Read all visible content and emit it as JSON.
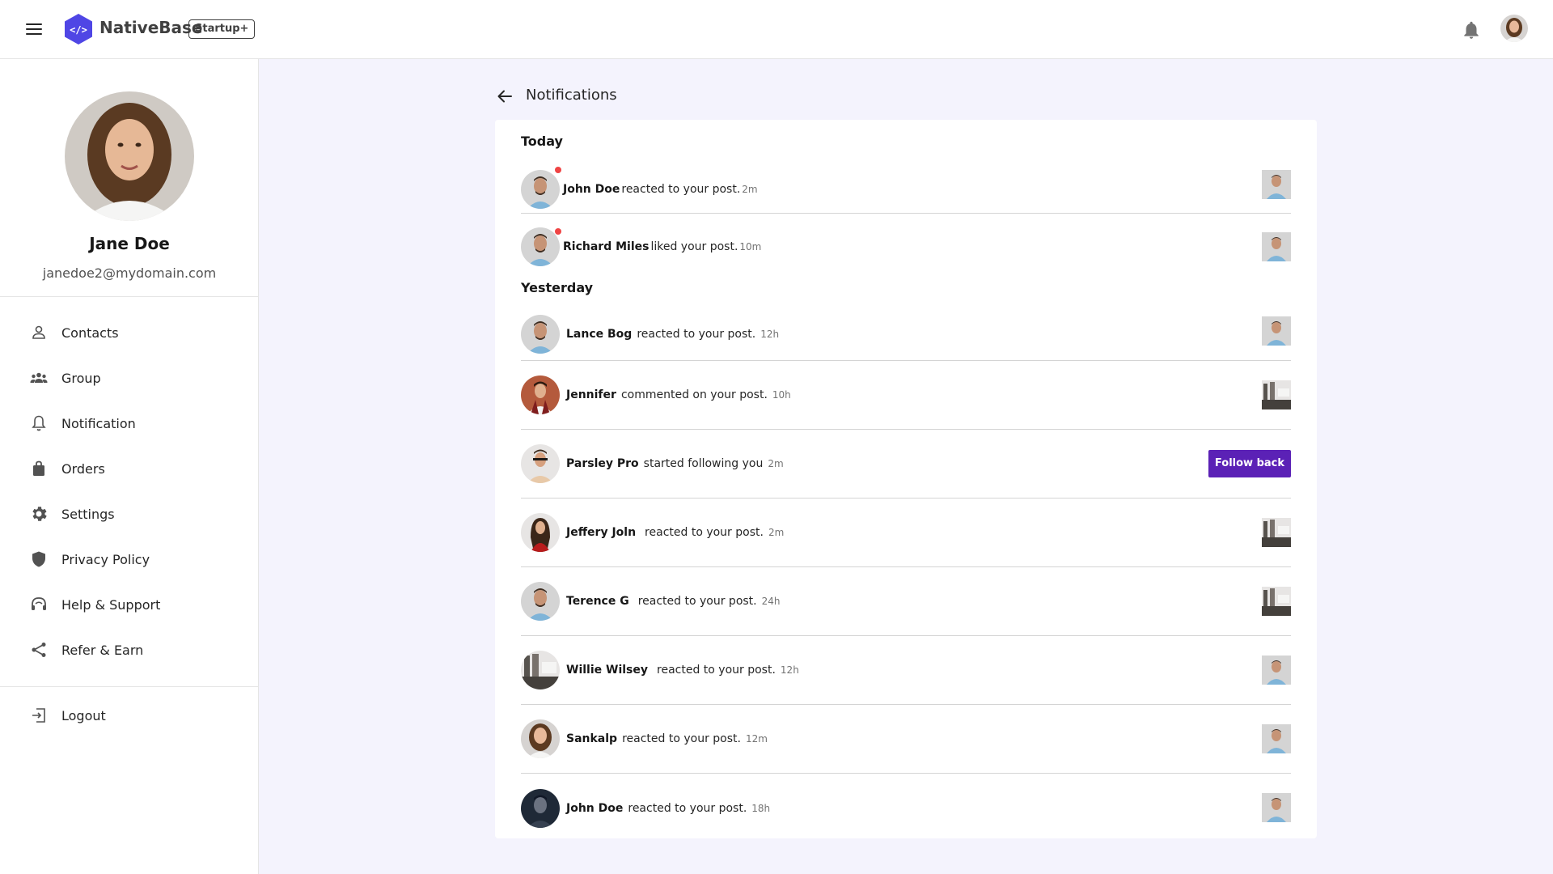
{
  "header": {
    "brand": "NativeBase",
    "plan_badge": "Startup+"
  },
  "sidebar": {
    "profile": {
      "name": "Jane Doe",
      "email": "janedoe2@mydomain.com"
    },
    "items": [
      {
        "label": "Contacts",
        "icon": "person-icon"
      },
      {
        "label": "Group",
        "icon": "group-icon"
      },
      {
        "label": "Notification",
        "icon": "bell-icon"
      },
      {
        "label": "Orders",
        "icon": "bag-icon"
      },
      {
        "label": "Settings",
        "icon": "gear-icon"
      },
      {
        "label": "Privacy Policy",
        "icon": "shield-icon"
      },
      {
        "label": "Help & Support",
        "icon": "headset-icon"
      },
      {
        "label": "Refer & Earn",
        "icon": "share-icon"
      }
    ],
    "logout": {
      "label": "Logout",
      "icon": "logout-icon"
    }
  },
  "main": {
    "title": "Notifications",
    "sections": [
      {
        "title": "Today",
        "items": [
          {
            "name": "John Doe",
            "action": "reacted to your post.",
            "time": "2m",
            "unread": true,
            "thumb": "person-photo"
          },
          {
            "name": "Richard Miles",
            "action": "liked your post.",
            "time": "10m",
            "unread": true,
            "thumb": "person-photo"
          }
        ]
      },
      {
        "title": "Yesterday",
        "items": [
          {
            "name": "Lance Bog",
            "action": "reacted to your post.",
            "time": "12h",
            "thumb": "person-photo"
          },
          {
            "name": "Jennifer",
            "action": "commented on your post.",
            "time": "10h",
            "thumb": "room-photo"
          },
          {
            "name": "Parsley Pro",
            "action": "started following you",
            "time": "2m",
            "button": "Follow back"
          },
          {
            "name": "Jeffery Joln",
            "action": "reacted to your post.",
            "time": "2m",
            "thumb": "room-photo"
          },
          {
            "name": "Terence G",
            "action": "reacted to your post.",
            "time": "24h",
            "thumb": "room-photo"
          },
          {
            "name": "Willie Wilsey",
            "action": "reacted to your post.",
            "time": "12h",
            "thumb": "person-photo"
          },
          {
            "name": "Sankalp",
            "action": "reacted to your post.",
            "time": "12m",
            "thumb": "person-photo"
          },
          {
            "name": "John Doe",
            "action": "reacted to your post.",
            "time": "18h",
            "thumb": "person-photo"
          }
        ]
      }
    ]
  },
  "colors": {
    "accent": "#5b21b6",
    "logo": "#4f46e5",
    "unread_dot": "#ef4444",
    "main_bg": "#f4f3fd"
  }
}
